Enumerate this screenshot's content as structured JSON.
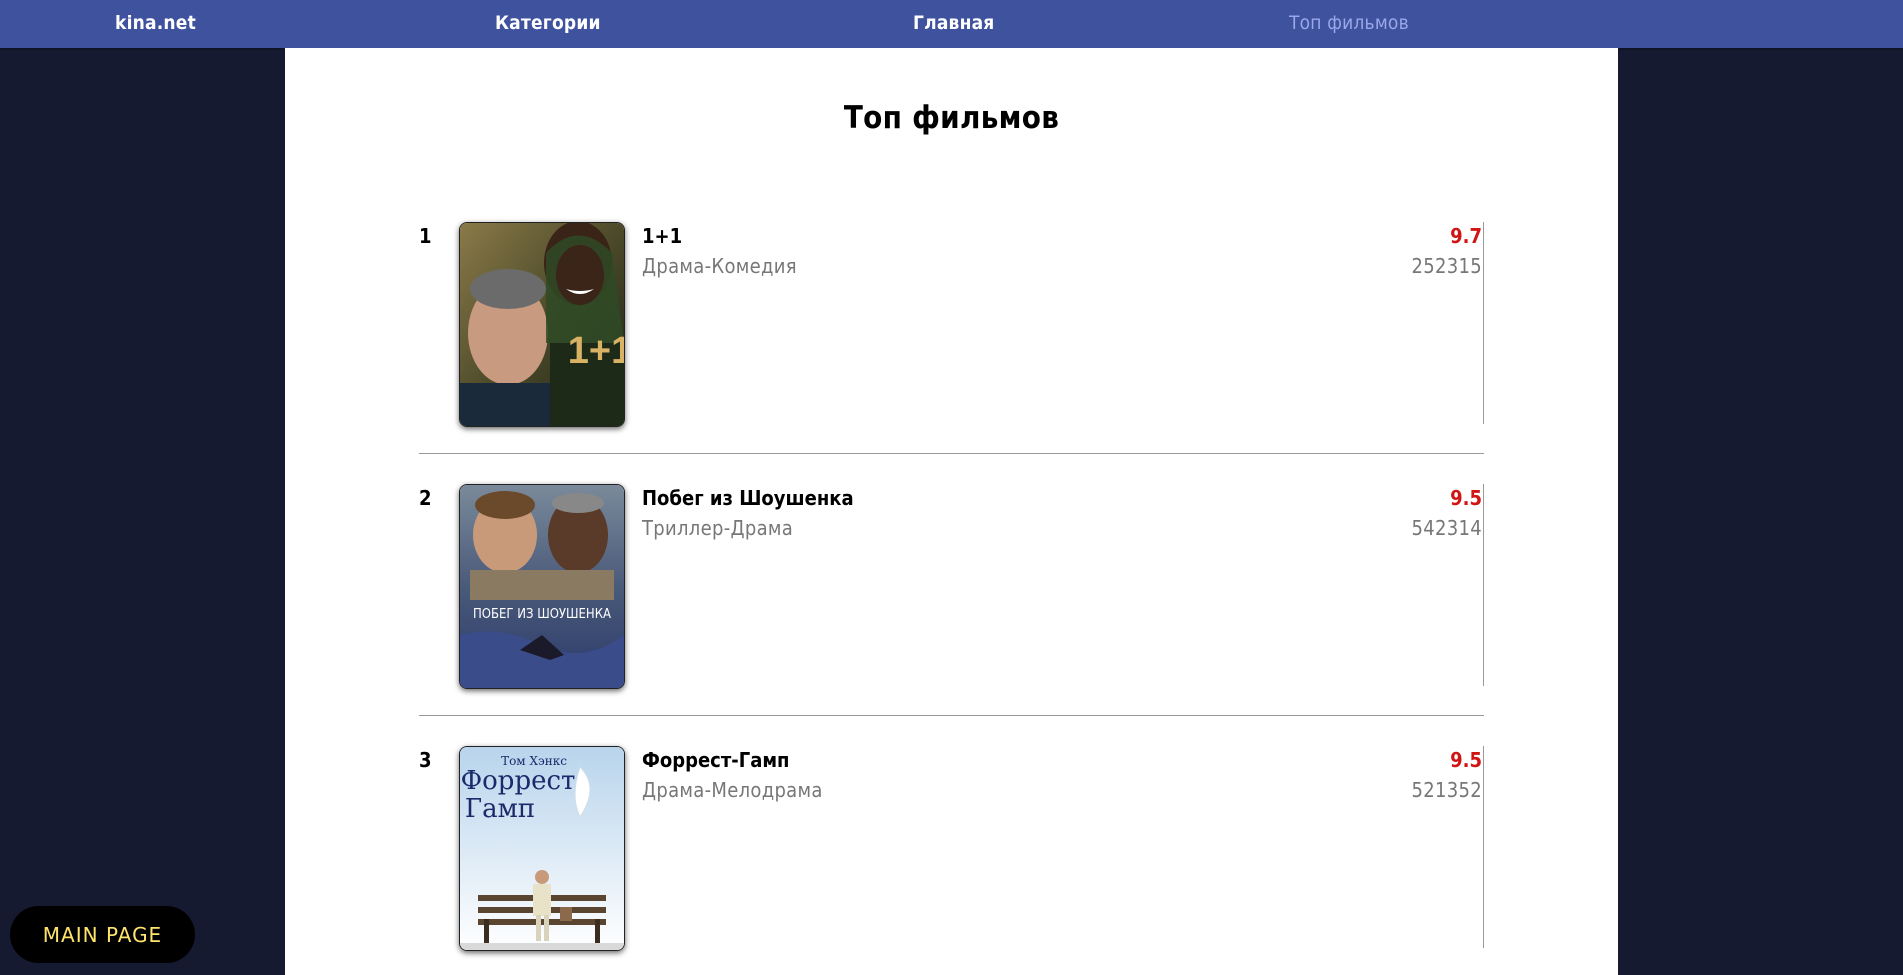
{
  "nav": {
    "brand": "kina.net",
    "categories": "Категории",
    "home": "Главная",
    "top_films": "Топ фильмов"
  },
  "page_title": "Топ фильмов",
  "films": [
    {
      "rank": "1",
      "title": "1+1",
      "genre": "Драма-Комедия",
      "rating": "9.7",
      "votes": "252315",
      "poster_text": "1+1"
    },
    {
      "rank": "2",
      "title": "Побег из Шоушенка",
      "genre": "Триллер-Драма",
      "rating": "9.5",
      "votes": "542314",
      "poster_text": "ПОБЕГ ИЗ ШОУШЕНКА"
    },
    {
      "rank": "3",
      "title": "Форрест-Гамп",
      "genre": "Драма-Мелодрама",
      "rating": "9.5",
      "votes": "521352",
      "poster_text": [
        "Том Хэнкс",
        "Форрест",
        "Гамп"
      ]
    }
  ],
  "main_page_button": "MAIN PAGE",
  "colors": {
    "background": "#151a30",
    "navbar": "#3f529e",
    "active_nav": "#9aa8ea",
    "rating": "#d11515",
    "button_text": "#ffe46b"
  }
}
